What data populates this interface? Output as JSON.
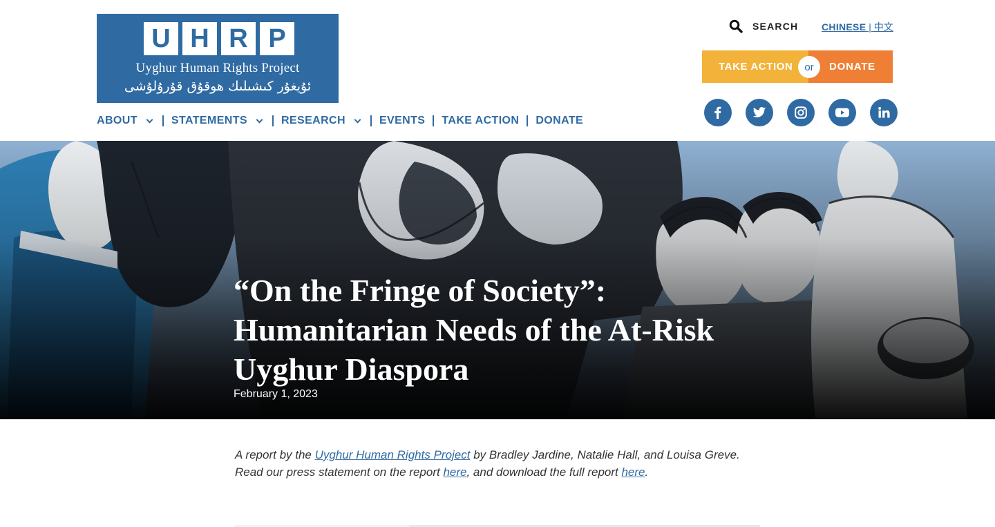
{
  "logo": {
    "letters": [
      "U",
      "H",
      "R",
      "P"
    ],
    "name": "Uyghur Human Rights Project",
    "uyghur_name": "ئۇيغۇر كىشىلىك ھوقۇق قۇرۇلۇشى"
  },
  "nav": {
    "items": [
      {
        "label": "About",
        "dropdown": true
      },
      {
        "label": "Statements",
        "dropdown": true
      },
      {
        "label": "Research",
        "dropdown": true
      },
      {
        "label": "Events",
        "dropdown": false
      },
      {
        "label": "Take Action",
        "dropdown": false
      },
      {
        "label": "Donate",
        "dropdown": false
      }
    ]
  },
  "search": {
    "label": "SEARCH",
    "icon": "search-icon"
  },
  "language": {
    "label": "CHINESE",
    "separator": "|",
    "native": "中文"
  },
  "cta": {
    "take_action": "TAKE ACTION",
    "or": "or",
    "donate": "DONATE"
  },
  "social": {
    "icons": [
      "facebook-icon",
      "twitter-icon",
      "instagram-icon",
      "youtube-icon",
      "linkedin-icon"
    ]
  },
  "colors": {
    "brand_blue": "#2f6aa3",
    "take_action_yellow": "#f3b23a",
    "donate_orange": "#ef7f35"
  },
  "hero": {
    "title": "“On the Fringe of Society”: Humanitarian Needs of the At-Risk Uyghur Diaspora",
    "date": "February 1, 2023"
  },
  "intro": {
    "part1": "A report by the ",
    "link_org": "Uyghur Human Rights Project",
    "part2": " by Bradley Jardine, Natalie Hall, and Louisa Greve. Read our press statement on the report ",
    "link_statement": "here",
    "part3": ", and download the full report ",
    "link_report": "here",
    "part4": "."
  }
}
